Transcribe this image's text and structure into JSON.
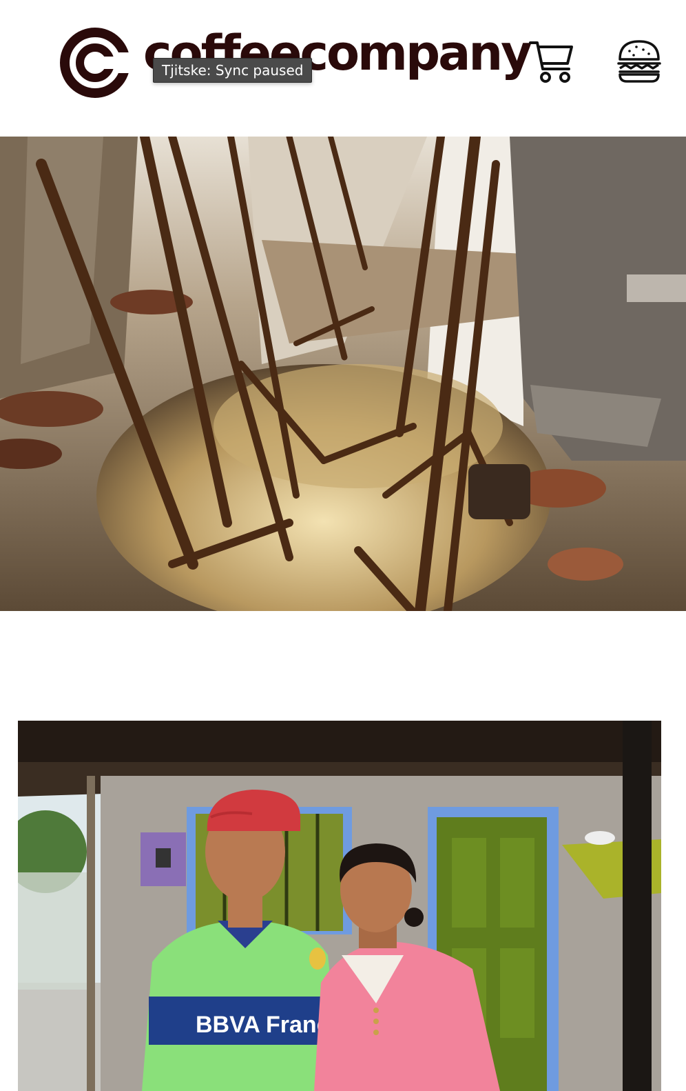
{
  "brand": {
    "name": "coffeecompany",
    "logo_color": "#2a0a0a"
  },
  "tooltip": {
    "text": "Tjitske: Sync paused"
  },
  "header": {
    "cart_icon": "shopping-cart-icon",
    "menu_icon": "hamburger-icon"
  },
  "hero_image": {
    "subject": "coffee-washing-channel-photo"
  },
  "farmers_image": {
    "subject": "coffee-farmers-portrait-photo",
    "shirt_print": "BBVA Francés"
  },
  "colors": {
    "background": "#ffffff",
    "accent": "#2a0a0a"
  }
}
